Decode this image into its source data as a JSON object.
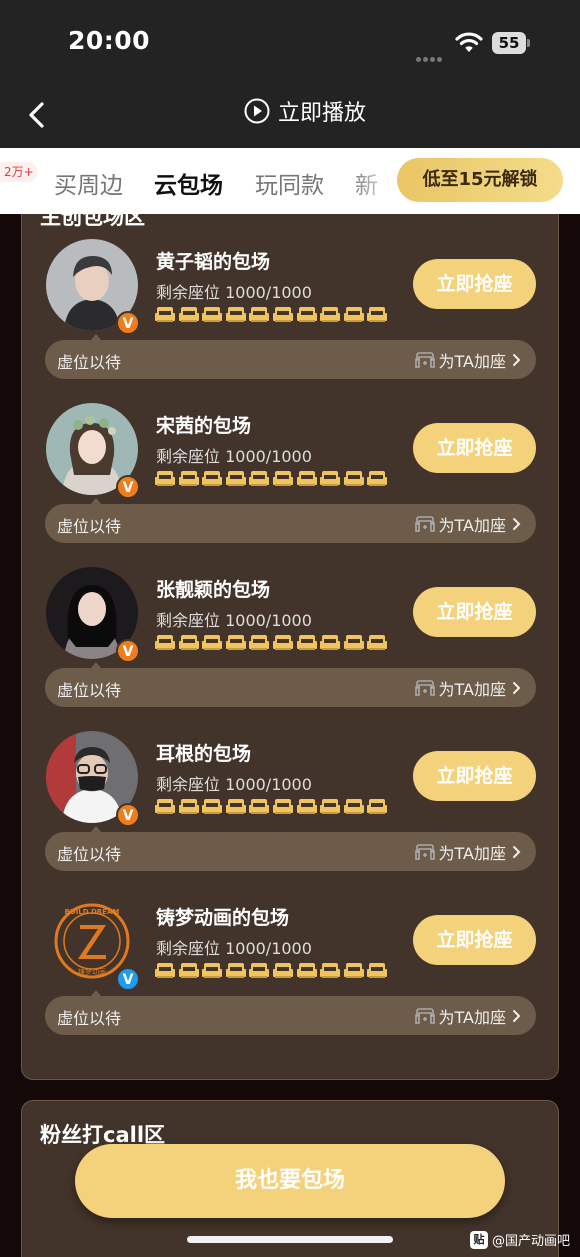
{
  "status_bar": {
    "time": "20:00",
    "battery": "55"
  },
  "nav": {
    "title": "立即播放"
  },
  "tabs": {
    "badge": "2万+",
    "items": [
      {
        "label": "买周边"
      },
      {
        "label": "云包场"
      },
      {
        "label": "玩同款"
      },
      {
        "label": "新"
      }
    ],
    "active_index": 1,
    "unlock_label": "低至15元解锁"
  },
  "section": {
    "title": "主创包场区",
    "rooms": [
      {
        "name": "黄子韬的包场",
        "seats": "剩余座位 1000/1000",
        "button": "立即抢座",
        "wait": "虚位以待",
        "add": "为TA加座",
        "badge": "V",
        "badge_color": "orange"
      },
      {
        "name": "宋茜的包场",
        "seats": "剩余座位 1000/1000",
        "button": "立即抢座",
        "wait": "虚位以待",
        "add": "为TA加座",
        "badge": "V",
        "badge_color": "orange"
      },
      {
        "name": "张靓颖的包场",
        "seats": "剩余座位 1000/1000",
        "button": "立即抢座",
        "wait": "虚位以待",
        "add": "为TA加座",
        "badge": "V",
        "badge_color": "orange"
      },
      {
        "name": "耳根的包场",
        "seats": "剩余座位 1000/1000",
        "button": "立即抢座",
        "wait": "虚位以待",
        "add": "为TA加座",
        "badge": "V",
        "badge_color": "orange"
      },
      {
        "name": "铸梦动画的包场",
        "seats": "剩余座位 1000/1000",
        "button": "立即抢座",
        "wait": "虚位以待",
        "add": "为TA加座",
        "badge": "V",
        "badge_color": "blue"
      }
    ]
  },
  "fan_section": {
    "title": "粉丝打call区"
  },
  "main_button": "我也要包场",
  "watermark": {
    "logo": "贴",
    "text": "@国产动画吧"
  },
  "logo_text": {
    "top": "BUILD DREAM",
    "bottom": "铸梦动画"
  },
  "colors": {
    "accent": "#f4d27b",
    "card": "#43342b",
    "bar": "#6d5c49",
    "seat_icon": "#f0c560"
  }
}
